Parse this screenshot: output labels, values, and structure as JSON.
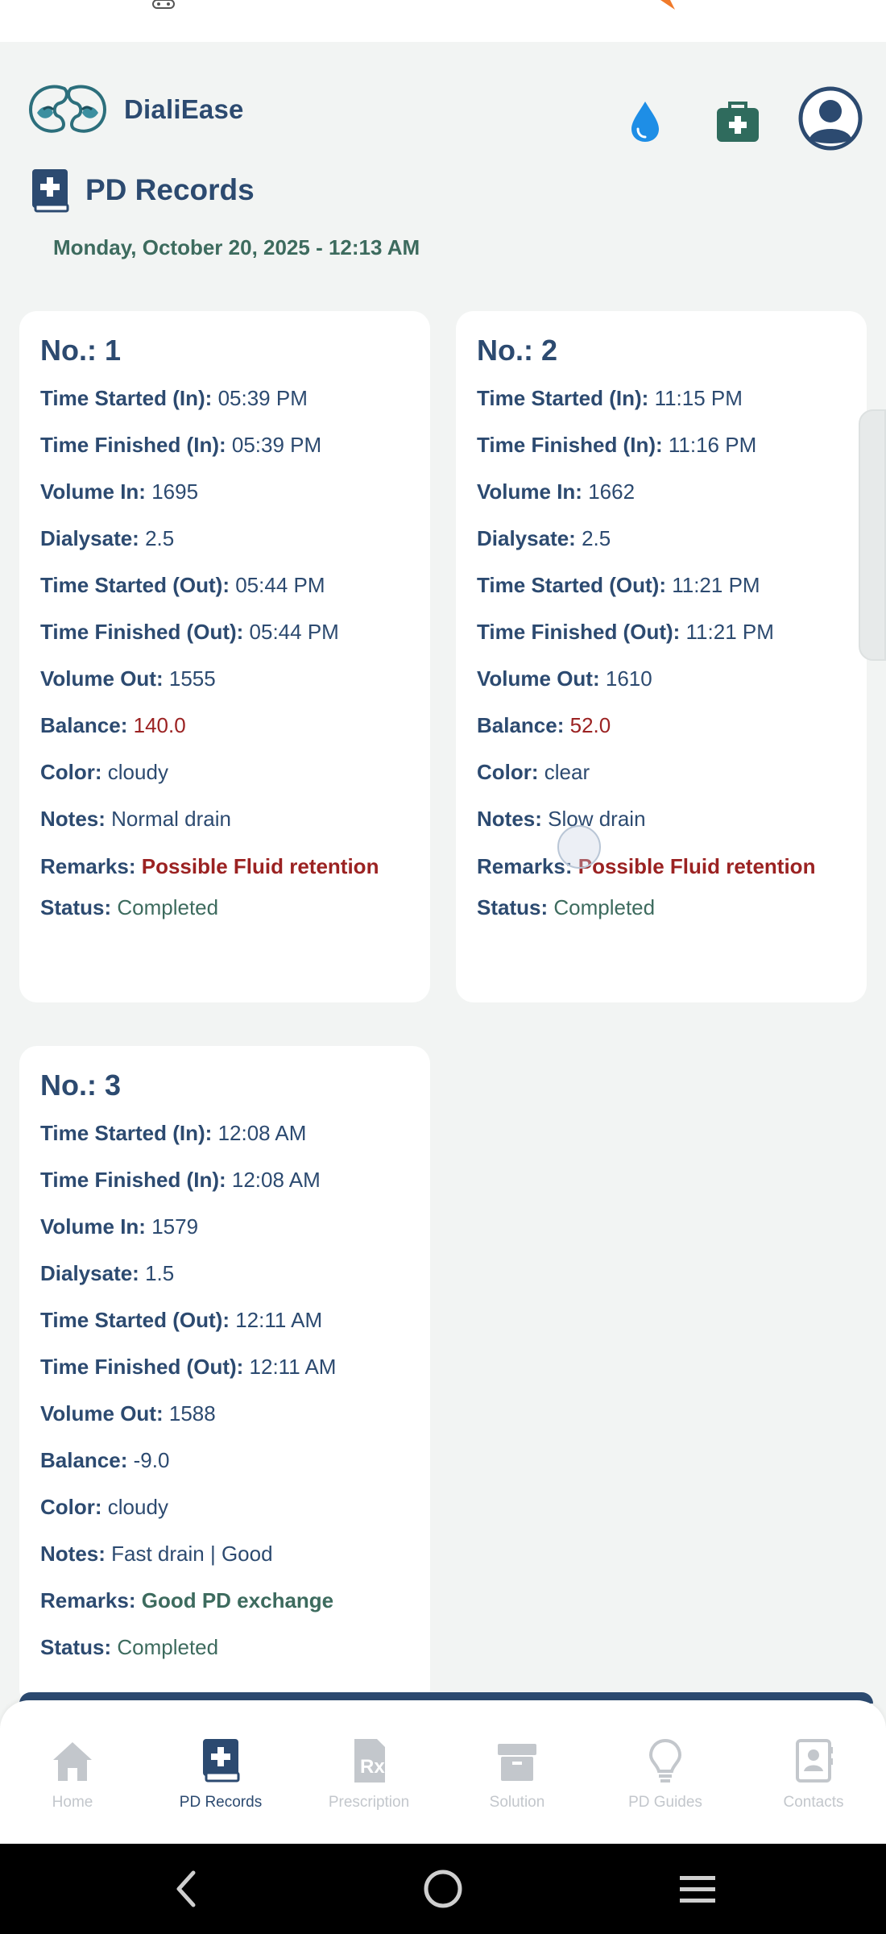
{
  "app": {
    "name": "DialiEase"
  },
  "page": {
    "title": "PD Records",
    "datetime": "Monday, October 20, 2025 - 12:13 AM"
  },
  "labels": {
    "no": "No.:",
    "time_started_in": "Time Started (In):",
    "time_finished_in": "Time Finished (In):",
    "volume_in": "Volume In:",
    "dialysate": "Dialysate:",
    "time_started_out": "Time Started (Out):",
    "time_finished_out": "Time Finished (Out):",
    "volume_out": "Volume Out:",
    "balance": "Balance:",
    "color": "Color:",
    "notes": "Notes:",
    "remarks": "Remarks:",
    "status": "Status:"
  },
  "records": [
    {
      "no": "1",
      "time_started_in": "05:39 PM",
      "time_finished_in": "05:39 PM",
      "volume_in": "1695",
      "dialysate": "2.5",
      "time_started_out": "05:44 PM",
      "time_finished_out": "05:44 PM",
      "volume_out": "1555",
      "balance": "140.0",
      "color": "cloudy",
      "notes": "Normal drain",
      "remarks": "Possible Fluid retention",
      "status": "Completed"
    },
    {
      "no": "2",
      "time_started_in": "11:15 PM",
      "time_finished_in": "11:16 PM",
      "volume_in": "1662",
      "dialysate": "2.5",
      "time_started_out": "11:21 PM",
      "time_finished_out": "11:21 PM",
      "volume_out": "1610",
      "balance": "52.0",
      "color": "clear",
      "notes": "Slow drain",
      "remarks": "Possible Fluid retention",
      "status": "Completed"
    },
    {
      "no": "3",
      "time_started_in": "12:08 AM",
      "time_finished_in": "12:08 AM",
      "volume_in": "1579",
      "dialysate": "1.5",
      "time_started_out": "12:11 AM",
      "time_finished_out": "12:11 AM",
      "volume_out": "1588",
      "balance": "-9.0",
      "color": "cloudy",
      "notes": "Fast drain | Good",
      "remarks": "Good PD exchange",
      "status": "Completed"
    }
  ],
  "nav": {
    "items": [
      {
        "label": "Home",
        "icon": "home-icon"
      },
      {
        "label": "PD Records",
        "icon": "pd-records-icon",
        "active": true
      },
      {
        "label": "Prescription",
        "icon": "prescription-icon"
      },
      {
        "label": "Solution",
        "icon": "solution-box-icon"
      },
      {
        "label": "PD Guides",
        "icon": "lightbulb-icon"
      },
      {
        "label": "Contacts",
        "icon": "contacts-icon"
      }
    ]
  },
  "colors": {
    "primary": "#2c4a70",
    "green": "#3d6b5e",
    "alert_red": "#9b2222",
    "background": "#f2f4f3",
    "nav_inactive": "#c3c7cc"
  }
}
